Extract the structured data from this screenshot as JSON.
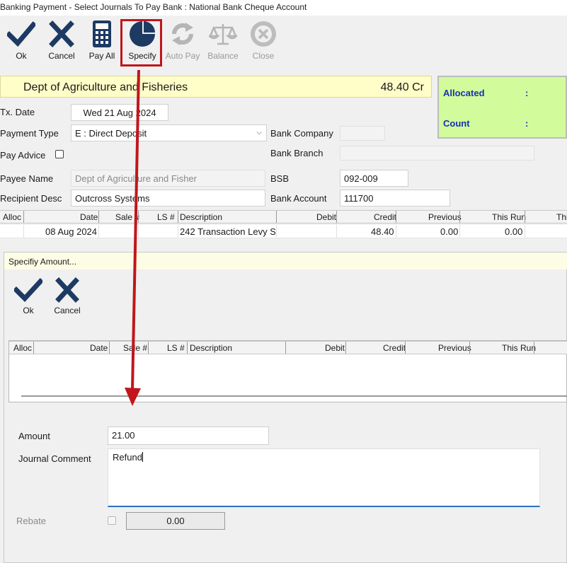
{
  "window": {
    "title": "Banking Payment - Select Journals To Pay   Bank : National Bank Cheque Account"
  },
  "toolbar": {
    "ok": "Ok",
    "cancel": "Cancel",
    "pay_all": "Pay All",
    "specify": "Specify",
    "auto_pay": "Auto Pay",
    "balance": "Balance",
    "close": "Close"
  },
  "payee_bar": {
    "name": "Dept of Agriculture and Fisheries",
    "amount": "48.40 Cr"
  },
  "alloc_panel": {
    "allocated_label": "Allocated",
    "count_label": "Count",
    "colon": ":"
  },
  "form": {
    "tx_date_label": "Tx. Date",
    "tx_date_value": "Wed 21 Aug 2024",
    "payment_type_label": "Payment Type",
    "payment_type_value": "E : Direct Deposit",
    "pay_advice_label": "Pay Advice",
    "payee_name_label": "Payee Name",
    "payee_name_value": "Dept of Agriculture and Fisher",
    "recipient_desc_label": "Recipient Desc",
    "recipient_desc_value": "Outcross Systems",
    "bank_company_label": "Bank Company",
    "bank_branch_label": "Bank Branch",
    "bsb_label": "BSB",
    "bsb_value": "092-009",
    "bank_account_label": "Bank Account",
    "bank_account_value": "111700"
  },
  "main_grid": {
    "headers": [
      "Alloc",
      "Date",
      "Sale #",
      "LS #",
      "Description",
      "Debit",
      "Credit",
      "Previous",
      "This Run",
      "Thi"
    ],
    "rows": [
      {
        "alloc": "",
        "date": "08 Aug 2024",
        "sale": "",
        "ls": "",
        "description": "242 Transaction Levy S",
        "debit": "",
        "credit": "48.40",
        "previous": "0.00",
        "this_run": "0.00"
      }
    ]
  },
  "dialog": {
    "title": "Specifiy Amount...",
    "ok": "Ok",
    "cancel": "Cancel",
    "grid_headers": [
      "Alloc",
      "Date",
      "Sale #",
      "LS #",
      "Description",
      "Debit",
      "Credit",
      "Previous",
      "This Run"
    ],
    "amount_label": "Amount",
    "amount_value": "21.00",
    "comment_label": "Journal Comment",
    "comment_value": "Refund",
    "rebate_label": "Rebate",
    "rebate_value": "0.00"
  },
  "colors": {
    "icon_navy": "#1d3a63",
    "highlight_red": "#c0161c",
    "payee_yellow": "#fffdc8",
    "alloc_green": "#d2fb9c",
    "alloc_text": "#1630b8"
  }
}
